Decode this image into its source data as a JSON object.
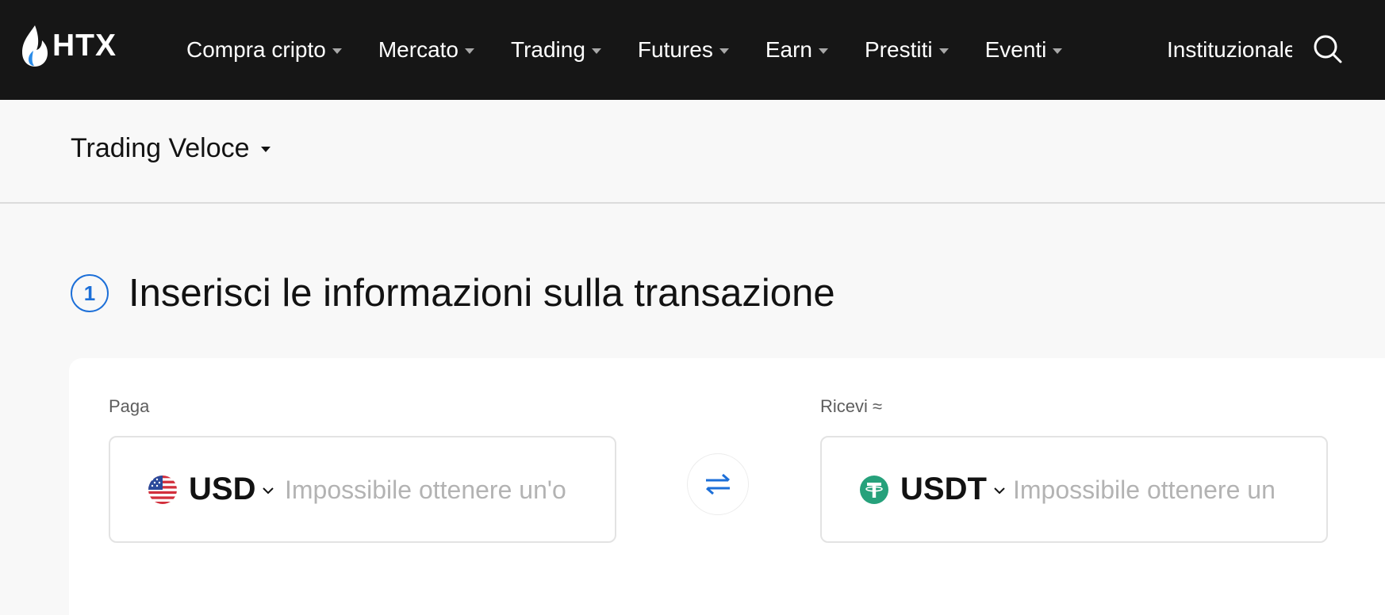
{
  "brand": {
    "logo_text": "HTX",
    "accent_color": "#1c6fd8"
  },
  "nav": {
    "items": [
      {
        "label": "Compra cripto"
      },
      {
        "label": "Mercato"
      },
      {
        "label": "Trading"
      },
      {
        "label": "Futures"
      },
      {
        "label": "Earn"
      },
      {
        "label": "Prestiti"
      },
      {
        "label": "Eventi"
      }
    ],
    "overflow_item": "Instituzionale",
    "search_icon": "search-icon"
  },
  "subheader": {
    "mode_label": "Trading Veloce"
  },
  "step": {
    "number": "1",
    "title": "Inserisci le informazioni sulla transazione"
  },
  "pay": {
    "label": "Paga",
    "currency": "USD",
    "currency_icon": "us-flag-icon",
    "placeholder": "Impossibile ottenere un'o"
  },
  "receive": {
    "label": "Ricevi ≈",
    "currency": "USDT",
    "currency_icon": "tether-icon",
    "placeholder": "Impossibile ottenere un"
  },
  "swap_icon": "swap-arrows-icon"
}
